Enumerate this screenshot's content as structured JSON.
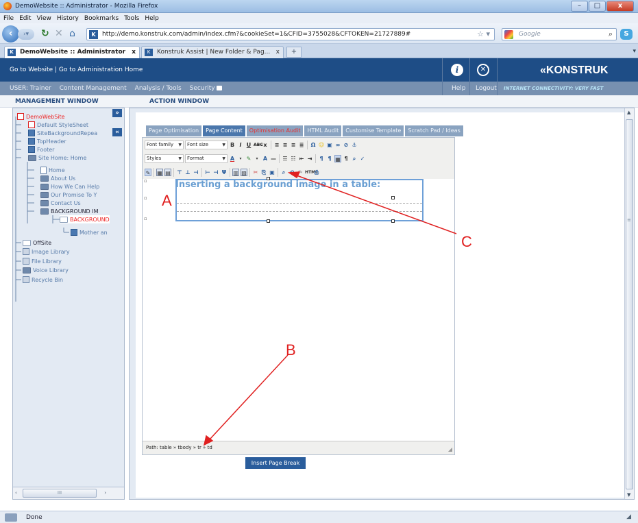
{
  "browser": {
    "title": "DemoWebsite :: Administrator - Mozilla Firefox",
    "window_buttons": [
      "–",
      "□",
      "x"
    ],
    "menu": [
      "File",
      "Edit",
      "View",
      "History",
      "Bookmarks",
      "Tools",
      "Help"
    ],
    "url": "http://demo.konstruk.com/admin/index.cfm?&cookieSet=1&CFID=3755028&CFTOKEN=21727889#",
    "url_icon": "K",
    "search_placeholder": "Google",
    "tabs": [
      {
        "label": "DemoWebsite :: Administrator",
        "close": "x",
        "active": true
      },
      {
        "label": "Konstruk Assist | New Folder & Pag...",
        "close": "x",
        "active": false
      }
    ],
    "new_tab": "+",
    "tab_list": "▾"
  },
  "app": {
    "header": {
      "go_to_website": "Go to Website",
      "divider": "|",
      "go_to_admin": "Go to Administration Home",
      "logo": "«KONSTRUK"
    },
    "subheader": {
      "user": "USER: Trainer",
      "content_management": "Content Management",
      "analysis": "Analysis / Tools",
      "security": "Security",
      "help": "Help",
      "logout": "Logout",
      "connectivity": "INTERNET CONNECTIVITY: VERY FAST"
    },
    "sections": {
      "management_window": "MANAGEMENT WINDOW",
      "action_window": "ACTION WINDOW"
    },
    "collapse_right": "»",
    "collapse_left": "«",
    "tree": [
      {
        "label": "DemoWebSite",
        "state": "open"
      },
      {
        "label": "Default StyleSheet"
      },
      {
        "label": "SiteBackgroundRepea"
      },
      {
        "label": "TopHeader"
      },
      {
        "label": "Footer"
      },
      {
        "label": "Site Home: Home"
      },
      {
        "label": "Home"
      },
      {
        "label": "About Us"
      },
      {
        "label": "How We Can Help"
      },
      {
        "label": "Our Promise To Y"
      },
      {
        "label": "Contact Us"
      },
      {
        "label": "BACKGROUND IM"
      },
      {
        "label": "BACKGROUND"
      },
      {
        "label": "Mother an"
      },
      {
        "label": "OffSite"
      },
      {
        "label": "Image Library"
      },
      {
        "label": "File Library"
      },
      {
        "label": "Voice Library"
      },
      {
        "label": "Recycle Bin"
      }
    ],
    "scroll_left_arrow": "‹",
    "scroll_right_arrow": "›",
    "scroll_thumb": "III",
    "content_tabs": [
      {
        "label": "Page Optimisation",
        "state": "normal"
      },
      {
        "label": "Page Content",
        "state": "active"
      },
      {
        "label": "Optimisation Audit",
        "state": "warning"
      },
      {
        "label": "HTML Audit",
        "state": "normal"
      },
      {
        "label": "Customise Template",
        "state": "normal"
      },
      {
        "label": "Scratch Pad / Ideas",
        "state": "normal"
      }
    ],
    "editor": {
      "font_family": "Font family",
      "font_size": "Font size",
      "styles": "Styles",
      "format": "Format",
      "heading": "Inserting a background image in a table:",
      "path": "Path: table » tbody » tr » td",
      "insert_page_break": "Insert Page Break"
    },
    "status": "Done"
  },
  "annotations": [
    "A",
    "B",
    "C"
  ],
  "colors": {
    "header_bg": "#1e4d86",
    "subheader_bg": "#7790b0",
    "panel_bg": "#e3eaf3",
    "accent": "#2a5d9c",
    "annotation_red": "#e02020",
    "heading_blue": "#6a9fd2"
  }
}
